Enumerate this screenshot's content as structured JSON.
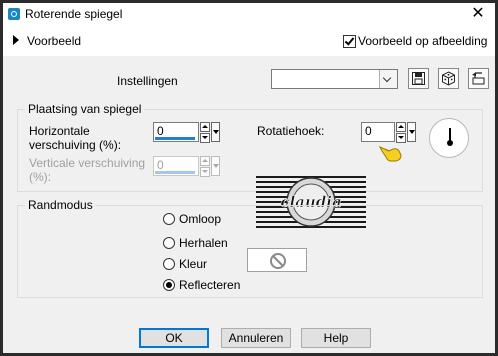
{
  "window": {
    "title": "Roterende spiegel",
    "close_glyph": "✕"
  },
  "preview": {
    "label": "Voorbeeld",
    "on_image_label": "Voorbeeld op afbeelding",
    "on_image_checked": true
  },
  "presets": {
    "label": "Instellingen",
    "selected_value": "",
    "icons": [
      "save-preset-icon",
      "randomize-icon",
      "reset-icon"
    ]
  },
  "placement": {
    "group_title": "Plaatsing van spiegel",
    "horizontal_label_1": "Horizontale",
    "horizontal_label_2": "verschuiving (%):",
    "horizontal_value": "0",
    "vertical_label_1": "Verticale verschuiving",
    "vertical_label_2": "(%):",
    "vertical_value": "0",
    "vertical_enabled": false,
    "rotation_label": "Rotatiehoek:",
    "rotation_value": "0"
  },
  "watermark": {
    "text": "claudia"
  },
  "edge_mode": {
    "group_title": "Randmodus",
    "options": [
      "Omloop",
      "Herhalen",
      "Kleur",
      "Reflecteren"
    ],
    "selected": "Reflecteren"
  },
  "buttons": {
    "ok": "OK",
    "cancel": "Annuleren",
    "help": "Help"
  },
  "colors": {
    "accent": "#0078d7",
    "frame": "#2b2b2b",
    "dialog_bg": "#f0f0f0"
  }
}
